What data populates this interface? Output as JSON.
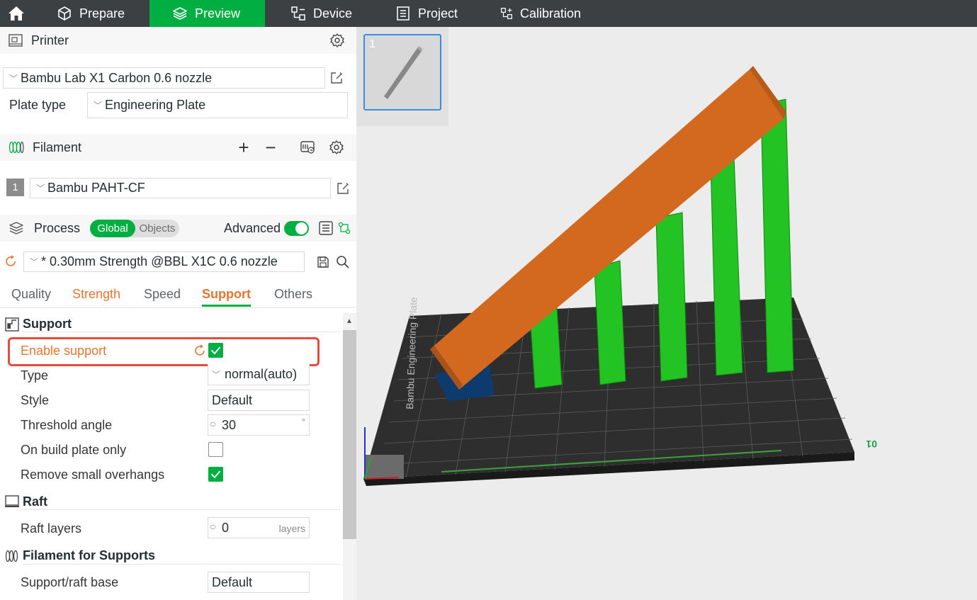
{
  "nav": {
    "home_icon": "home-icon",
    "items": [
      {
        "label": "Prepare",
        "icon": "cube-icon"
      },
      {
        "label": "Preview",
        "icon": "layers-icon"
      },
      {
        "label": "Device",
        "icon": "device-icon"
      },
      {
        "label": "Project",
        "icon": "project-icon"
      },
      {
        "label": "Calibration",
        "icon": "calibration-icon"
      }
    ],
    "active": "Preview"
  },
  "printer": {
    "title": "Printer",
    "selected": "Bambu Lab X1 Carbon 0.6 nozzle",
    "plate_type_label": "Plate type",
    "plate_type": "Engineering Plate"
  },
  "filament": {
    "title": "Filament",
    "add_label": "+",
    "remove_label": "−",
    "slot_number": "1",
    "selected": "Bambu PAHT-CF"
  },
  "process": {
    "title": "Process",
    "global_label": "Global",
    "objects_label": "Objects",
    "advanced_label": "Advanced",
    "advanced_on": true,
    "preset": "* 0.30mm Strength @BBL X1C 0.6 nozzle"
  },
  "tabs": [
    {
      "label": "Quality"
    },
    {
      "label": "Strength"
    },
    {
      "label": "Speed"
    },
    {
      "label": "Support"
    },
    {
      "label": "Others"
    }
  ],
  "support": {
    "title": "Support",
    "enable_label": "Enable support",
    "enable_checked": true,
    "type_label": "Type",
    "type_value": "normal(auto)",
    "style_label": "Style",
    "style_value": "Default",
    "threshold_label": "Threshold angle",
    "threshold_value": "30",
    "threshold_unit": "°",
    "build_plate_label": "On build plate only",
    "build_plate_checked": false,
    "remove_overhangs_label": "Remove small overhangs",
    "remove_overhangs_checked": true
  },
  "raft": {
    "title": "Raft",
    "layers_label": "Raft layers",
    "layers_value": "0",
    "layers_unit": "layers"
  },
  "filament_supports": {
    "title": "Filament for Supports",
    "base_label": "Support/raft base",
    "base_value": "Default"
  },
  "viewport": {
    "plate_number": "1",
    "plate_text": "Bambu Engineering Plate",
    "axis_label": "01",
    "colors": {
      "model": "#d2691e",
      "support": "#22c322",
      "plate": "#2b2b2b",
      "accent": "#00ae42"
    }
  }
}
